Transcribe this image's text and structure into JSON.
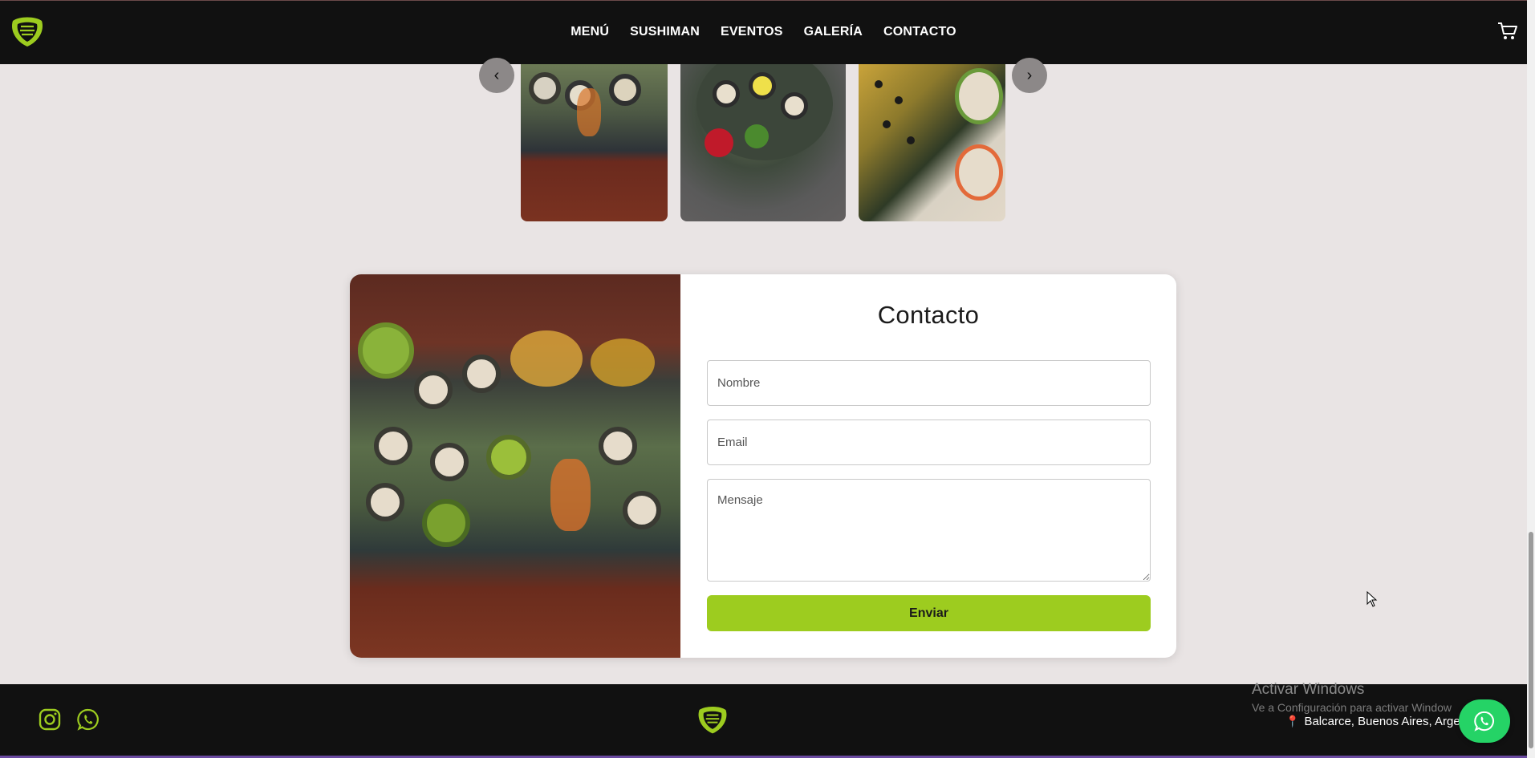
{
  "header": {
    "logo_icon": "leaf-logo-icon",
    "nav": [
      "MENÚ",
      "SUSHIMAN",
      "EVENTOS",
      "GALERÍA",
      "CONTACTO"
    ],
    "cart_icon": "shopping-cart-icon"
  },
  "gallery": {
    "prev_icon": "chevron-left-icon",
    "next_icon": "chevron-right-icon",
    "prev_glyph": "‹",
    "next_glyph": "›"
  },
  "contact": {
    "title": "Contacto",
    "name_placeholder": "Nombre",
    "email_placeholder": "Email",
    "message_placeholder": "Mensaje",
    "submit_label": "Enviar"
  },
  "footer": {
    "social_icons": [
      "instagram-icon",
      "whatsapp-icon"
    ],
    "address": "Balcarce, Buenos Aires, Arge",
    "windows_title": "Activar Windows",
    "windows_subtitle": "Ve a Configuración para activar Window"
  },
  "colors": {
    "accent": "#9dcc1f",
    "dark": "#111111",
    "background": "#e9e4e4",
    "whatsapp": "#25d366"
  }
}
